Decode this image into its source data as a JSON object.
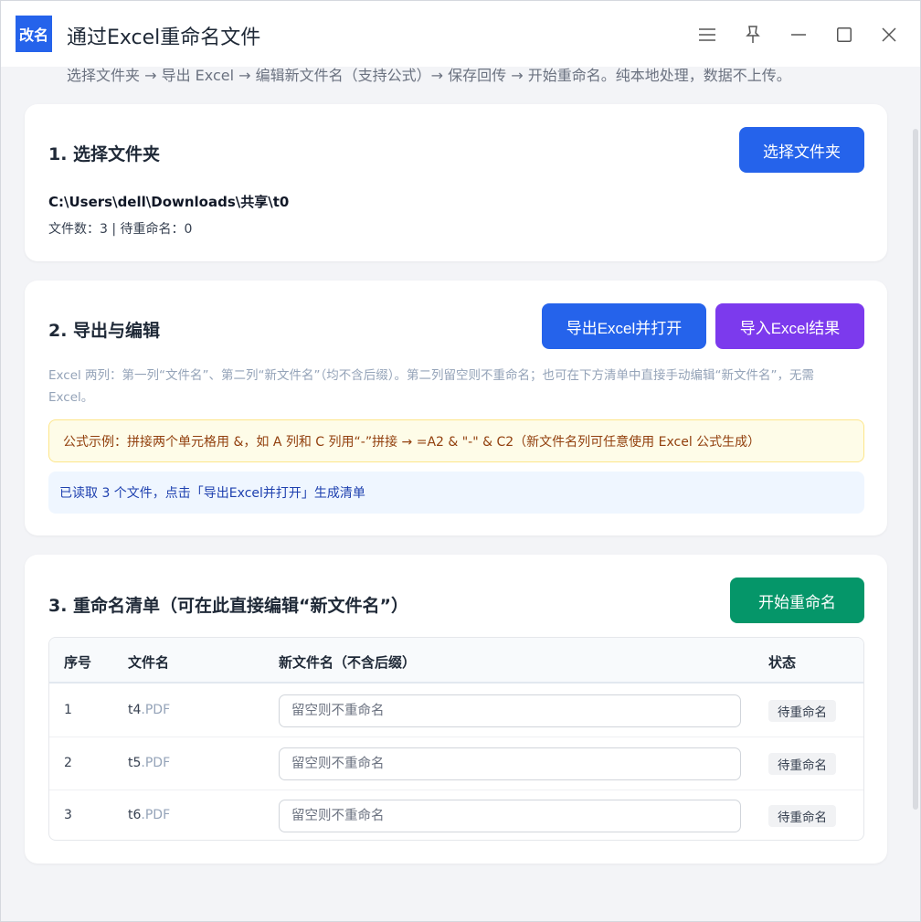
{
  "app": {
    "logo_text": "改名",
    "title": "通过Excel重命名文件",
    "subtitle": "选择文件夹 → 导出 Excel → 编辑新文件名（支持公式）→ 保存回传 → 开始重命名。纯本地处理，数据不上传。"
  },
  "window_controls": [
    "menu-icon",
    "pin-icon",
    "minimize-icon",
    "maximize-icon",
    "close-icon"
  ],
  "step1": {
    "title": "1. 选择文件夹",
    "button": "选择文件夹",
    "path": "C:\\Users\\dell\\Downloads\\共享\\t0",
    "counts": "文件数：3 | 待重命名：0"
  },
  "step2": {
    "title": "2. 导出与编辑",
    "export_button": "导出Excel并打开",
    "import_button": "导入Excel结果",
    "help": "Excel 两列：第一列“文件名”、第二列“新文件名”（均不含后缀）。第二列留空则不重命名；也可在下方清单中直接手动编辑“新文件名”，无需 Excel。",
    "formula_tip": "公式示例：拼接两个单元格用 &，如 A 列和 C 列用“-”拼接 → =A2 & \"-\" & C2（新文件名列可任意使用 Excel 公式生成）",
    "info": "已读取 3 个文件，点击「导出Excel并打开」生成清单"
  },
  "step3": {
    "title": "3. 重命名清单（可在此直接编辑“新文件名”）",
    "start_button": "开始重命名",
    "columns": [
      "序号",
      "文件名",
      "新文件名（不含后缀）",
      "状态"
    ],
    "rows": [
      {
        "no": "1",
        "name": "t4",
        "ext": ".PDF",
        "new_name": "",
        "placeholder": "留空则不重命名",
        "status": "待重命名"
      },
      {
        "no": "2",
        "name": "t5",
        "ext": ".PDF",
        "new_name": "",
        "placeholder": "留空则不重命名",
        "status": "待重命名"
      },
      {
        "no": "3",
        "name": "t6",
        "ext": ".PDF",
        "new_name": "",
        "placeholder": "留空则不重命名",
        "status": "待重命名"
      }
    ]
  },
  "colors": {
    "primary": "#2563eb",
    "purple": "#7c3aed",
    "green": "#059669",
    "formula_bg": "#fefce8",
    "info_bg": "#eff6ff"
  }
}
